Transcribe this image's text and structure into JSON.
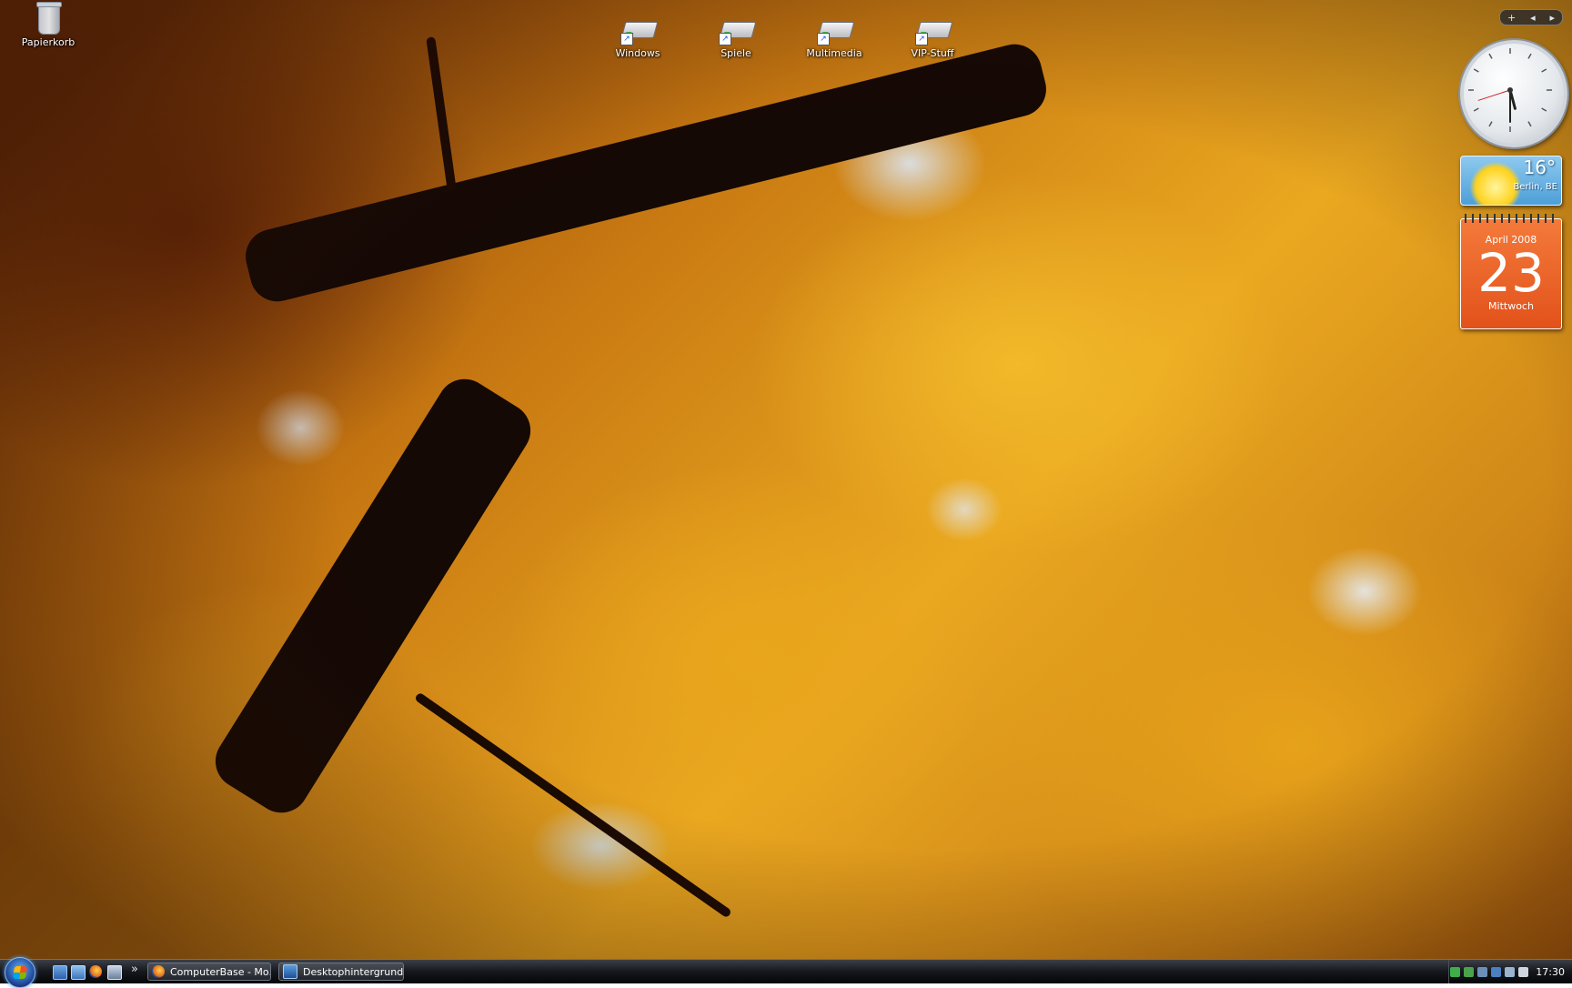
{
  "desktop": {
    "icons": [
      {
        "label": "Papierkorb",
        "icon": "recycle-bin-icon"
      },
      {
        "label": "Windows",
        "icon": "drive-shortcut-icon"
      },
      {
        "label": "Spiele",
        "icon": "drive-shortcut-icon"
      },
      {
        "label": "Multimedia",
        "icon": "drive-shortcut-icon"
      },
      {
        "label": "VIP-Stuff",
        "icon": "drive-shortcut-icon"
      }
    ]
  },
  "sidebar": {
    "controls": {
      "add": "+",
      "prev": "◂",
      "next": "▸"
    },
    "clock": {
      "hour": 5,
      "minute": 30,
      "second": 42
    },
    "weather": {
      "temperature": "16°",
      "city": "Berlin, BE"
    },
    "calendar": {
      "month": "April 2008",
      "day": "23",
      "weekday": "Mittwoch"
    }
  },
  "taskbar": {
    "quick_launch_chevron": "»",
    "buttons": [
      {
        "label": "ComputerBase - Mo...",
        "icon": "firefox-icon"
      },
      {
        "label": "Desktophintergrund",
        "icon": "display-properties-icon"
      }
    ],
    "clock": "17:30"
  },
  "colors": {
    "accent_blue": "#1a3e8c",
    "calendar_orange": "#e2521b",
    "weather_sky": "#4d9fd8"
  }
}
